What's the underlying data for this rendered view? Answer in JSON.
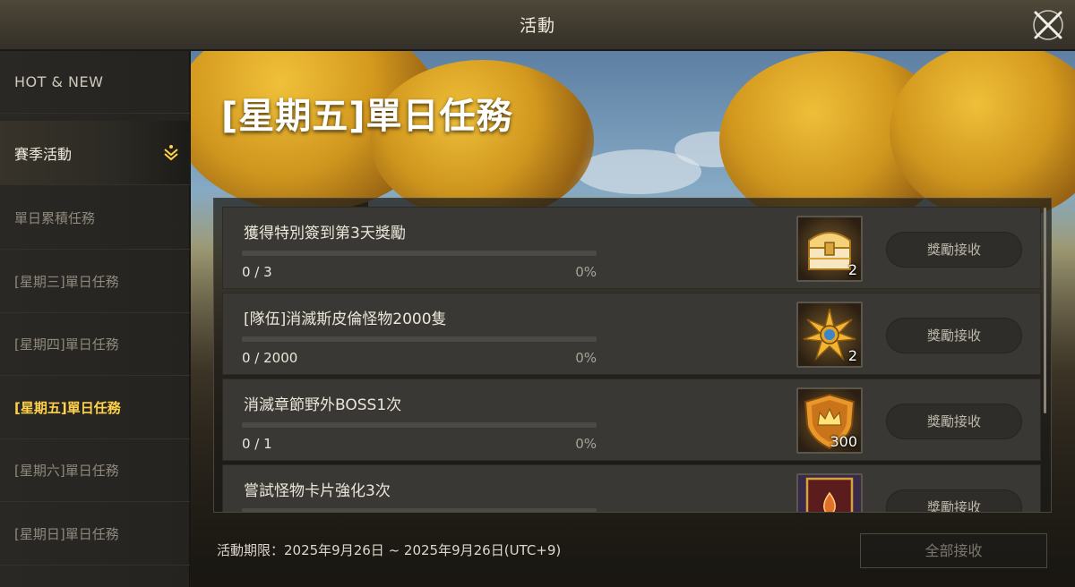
{
  "header": {
    "title": "活動"
  },
  "sidebar": {
    "items": [
      {
        "label": "HOT & NEW"
      },
      {
        "label": "賽季活動"
      },
      {
        "label": "單日累積任務"
      },
      {
        "label": "[星期三]單日任務"
      },
      {
        "label": "[星期四]單日任務"
      },
      {
        "label": "[星期五]單日任務"
      },
      {
        "label": "[星期六]單日任務"
      },
      {
        "label": "[星期日]單日任務"
      }
    ]
  },
  "main": {
    "title": "[星期五]單日任務",
    "missions": [
      {
        "title": "獲得特別簽到第3天獎勵",
        "count": "0 / 3",
        "percent": "0%",
        "progress": 0,
        "reward_icon": "golden-chest-icon",
        "reward_qty": "2",
        "claim_label": "獎勵接收"
      },
      {
        "title": "[隊伍]消滅斯皮倫怪物2000隻",
        "count": "0 / 2000",
        "percent": "0%",
        "progress": 0,
        "reward_icon": "sun-emblem-icon",
        "reward_qty": "2",
        "claim_label": "獎勵接收"
      },
      {
        "title": "消滅章節野外BOSS1次",
        "count": "0 / 1",
        "percent": "0%",
        "progress": 0,
        "reward_icon": "crown-shield-icon",
        "reward_qty": "300",
        "claim_label": "獎勵接收"
      },
      {
        "title": "嘗試怪物卡片強化3次",
        "count": "",
        "percent": "",
        "progress": 0,
        "reward_icon": "monster-card-icon",
        "reward_qty": "",
        "claim_label": "獎勵接收"
      }
    ],
    "period": "活動期限：2025年9月26日 ~ 2025年9月26日(UTC+9)",
    "claim_all_label": "全部接收"
  },
  "colors": {
    "active_tab": "#ffd24a",
    "progress_fill": "#e0b24a"
  }
}
